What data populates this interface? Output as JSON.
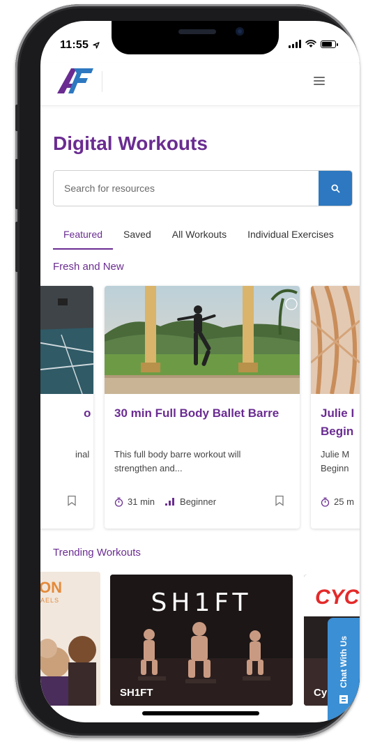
{
  "status_bar": {
    "time": "11:55"
  },
  "header": {
    "logo_alt": "AF",
    "menu_icon": "hamburger-menu-icon"
  },
  "page": {
    "title": "Digital Workouts"
  },
  "search": {
    "placeholder": "Search for resources",
    "button_icon": "search-icon"
  },
  "tabs": [
    {
      "label": "Featured",
      "active": true
    },
    {
      "label": "Saved",
      "active": false
    },
    {
      "label": "All Workouts",
      "active": false
    },
    {
      "label": "Individual Exercises",
      "active": false
    }
  ],
  "sections": {
    "fresh": "Fresh and New",
    "trending": "Trending Workouts"
  },
  "fresh_cards": [
    {
      "title_tail": "o",
      "desc_tail": "inal"
    },
    {
      "title": "30 min Full Body Ballet Barre",
      "description": "This full body barre workout will strengthen and...",
      "duration": "31 min",
      "level": "Beginner"
    },
    {
      "title": "Julie I Begin",
      "desc": "Julie M Beginn",
      "duration": "25 m"
    }
  ],
  "trending_cards": [
    {
      "logo_text": "ON",
      "sub_text": "AELS"
    },
    {
      "logo_text": "SH1FT",
      "label": "SH1FT"
    },
    {
      "logo_text": "CYC",
      "label": "Cy"
    }
  ],
  "chat": {
    "label": "Chat With Us"
  },
  "colors": {
    "brand_purple": "#6a2c91",
    "search_blue": "#2d78c0",
    "chat_blue": "#3b8fd4"
  }
}
